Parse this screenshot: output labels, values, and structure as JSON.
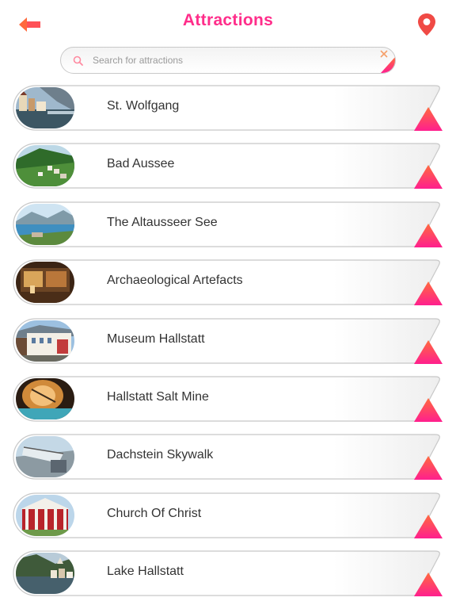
{
  "header": {
    "title": "Attractions",
    "back_icon": "arrow-left-icon",
    "map_icon": "location-pin-icon"
  },
  "search": {
    "placeholder": "Search for attractions",
    "value": "",
    "icon": "search-icon",
    "clear_icon": "close-icon"
  },
  "colors": {
    "accent": "#ff2d8a",
    "back_arrow": "#ff6a3d",
    "pin": "#f04a45",
    "corner_top": "#ff6a3d",
    "corner_bottom": "#ff1f8e",
    "row_text": "#333333"
  },
  "attractions": [
    {
      "label": "St. Wolfgang",
      "thumb": "lakeside-village-photo"
    },
    {
      "label": "Bad Aussee",
      "thumb": "green-valley-town-photo"
    },
    {
      "label": "The Altausseer See",
      "thumb": "lake-mountains-photo"
    },
    {
      "label": "Archaeological Artefacts",
      "thumb": "museum-interior-photo"
    },
    {
      "label": "Museum Hallstatt",
      "thumb": "museum-building-photo"
    },
    {
      "label": "Hallstatt Salt Mine",
      "thumb": "salt-mine-tunnel-photo"
    },
    {
      "label": "Dachstein Skywalk",
      "thumb": "skywalk-platform-photo"
    },
    {
      "label": "Church Of Christ",
      "thumb": "red-church-photo"
    },
    {
      "label": "Lake Hallstatt",
      "thumb": "lake-village-photo"
    }
  ]
}
